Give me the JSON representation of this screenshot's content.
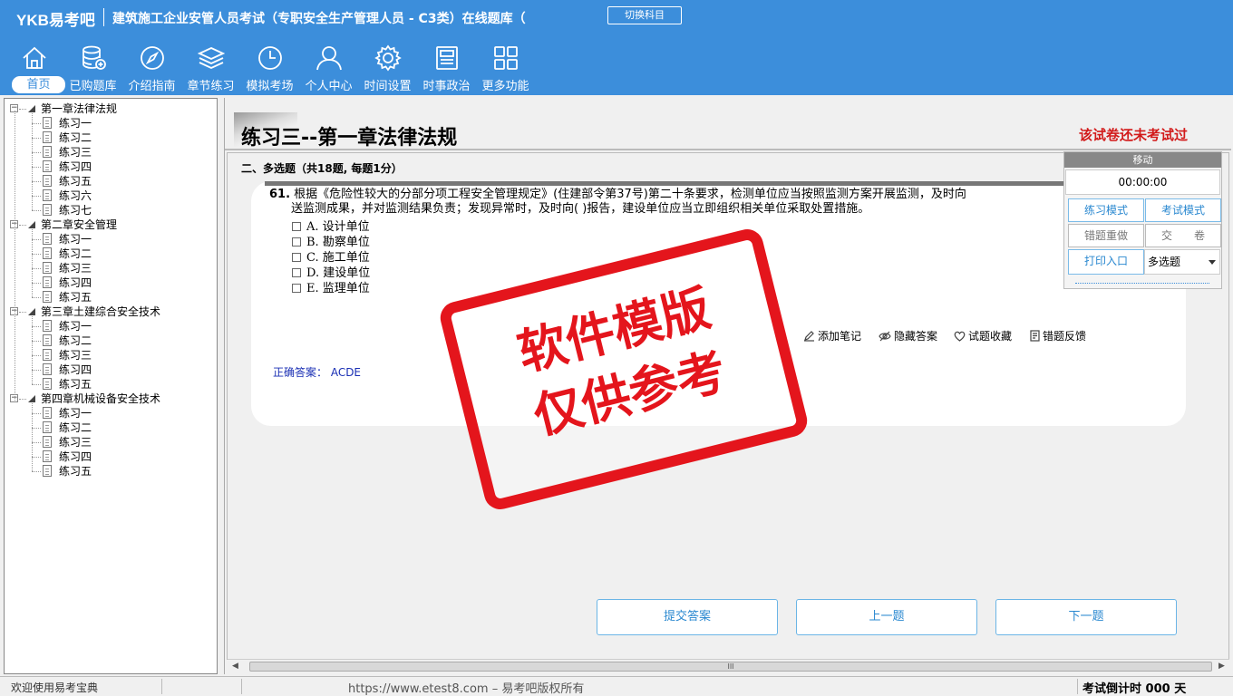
{
  "header": {
    "logo": "YKB易考吧",
    "title": "建筑施工企业安管人员考试（专职安全生产管理人员 - C3类）在线题库（",
    "switch_subject": "切换科目"
  },
  "nav": [
    {
      "label": "首页",
      "icon": "home-icon"
    },
    {
      "label": "已购题库",
      "icon": "database-icon"
    },
    {
      "label": "介绍指南",
      "icon": "compass-icon"
    },
    {
      "label": "章节练习",
      "icon": "layers-icon"
    },
    {
      "label": "模拟考场",
      "icon": "clock-icon"
    },
    {
      "label": "个人中心",
      "icon": "user-icon"
    },
    {
      "label": "时间设置",
      "icon": "gear-icon"
    },
    {
      "label": "时事政治",
      "icon": "news-icon"
    },
    {
      "label": "更多功能",
      "icon": "grid-icon"
    }
  ],
  "tree": {
    "chapters": [
      {
        "label": "第一章法律法规",
        "items": [
          "练习一",
          "练习二",
          "练习三",
          "练习四",
          "练习五",
          "练习六",
          "练习七"
        ]
      },
      {
        "label": "第二章安全管理",
        "items": [
          "练习一",
          "练习二",
          "练习三",
          "练习四",
          "练习五"
        ]
      },
      {
        "label": "第三章土建综合安全技术",
        "items": [
          "练习一",
          "练习二",
          "练习三",
          "练习四",
          "练习五"
        ]
      },
      {
        "label": "第四章机械设备安全技术",
        "items": [
          "练习一",
          "练习二",
          "练习三",
          "练习四",
          "练习五"
        ]
      }
    ]
  },
  "main": {
    "exercise_title": "练习三--第一章法律法规",
    "exam_status": "该试卷还未考试过",
    "section_head": "二、多选题（共18题, 每题1分）",
    "question": {
      "number": "61.",
      "text_line1": "根据《危险性较大的分部分项工程安全管理规定》(住建部令第37号)第二十条要求，检测单位应当按照监测方案开展监测，及时向",
      "text_line2": "送监测成果，并对监测结果负责；发现异常时，及时向(  )报告，建设单位应当立即组织相关单位采取处置措施。",
      "options": [
        "A. 设计单位",
        "B. 勘察单位",
        "C. 施工单位",
        "D. 建设单位",
        "E. 监理单位"
      ]
    },
    "tools": {
      "add_note": "添加笔记",
      "hide_answer": "隐藏答案",
      "favorite": "试题收藏",
      "report_error": "错题反馈"
    },
    "answer": "正确答案： ACDE",
    "watermark_line1": "软件模版",
    "watermark_line2": "仅供参考",
    "buttons": {
      "submit": "提交答案",
      "prev": "上一题",
      "next": "下一题"
    },
    "scroll_grip": "III"
  },
  "float_panel": {
    "head": "移动",
    "timer": "00:00:00",
    "practice_mode": "练习模式",
    "exam_mode": "考试模式",
    "redo_wrong": "错题重做",
    "submit_paper": "交　　卷",
    "print": "打印入口",
    "question_type": "多选题"
  },
  "status": {
    "welcome": "欢迎使用易考宝典",
    "copyright": "https://www.etest8.com – 易考吧版权所有",
    "countdown": "考试倒计时 000 天"
  },
  "colors": {
    "header_bg": "#3c8edb",
    "status_red": "#d21a1a",
    "watermark_red": "#e4151c",
    "answer_blue": "#1a2fb4",
    "button_border": "#6bb5e6"
  }
}
